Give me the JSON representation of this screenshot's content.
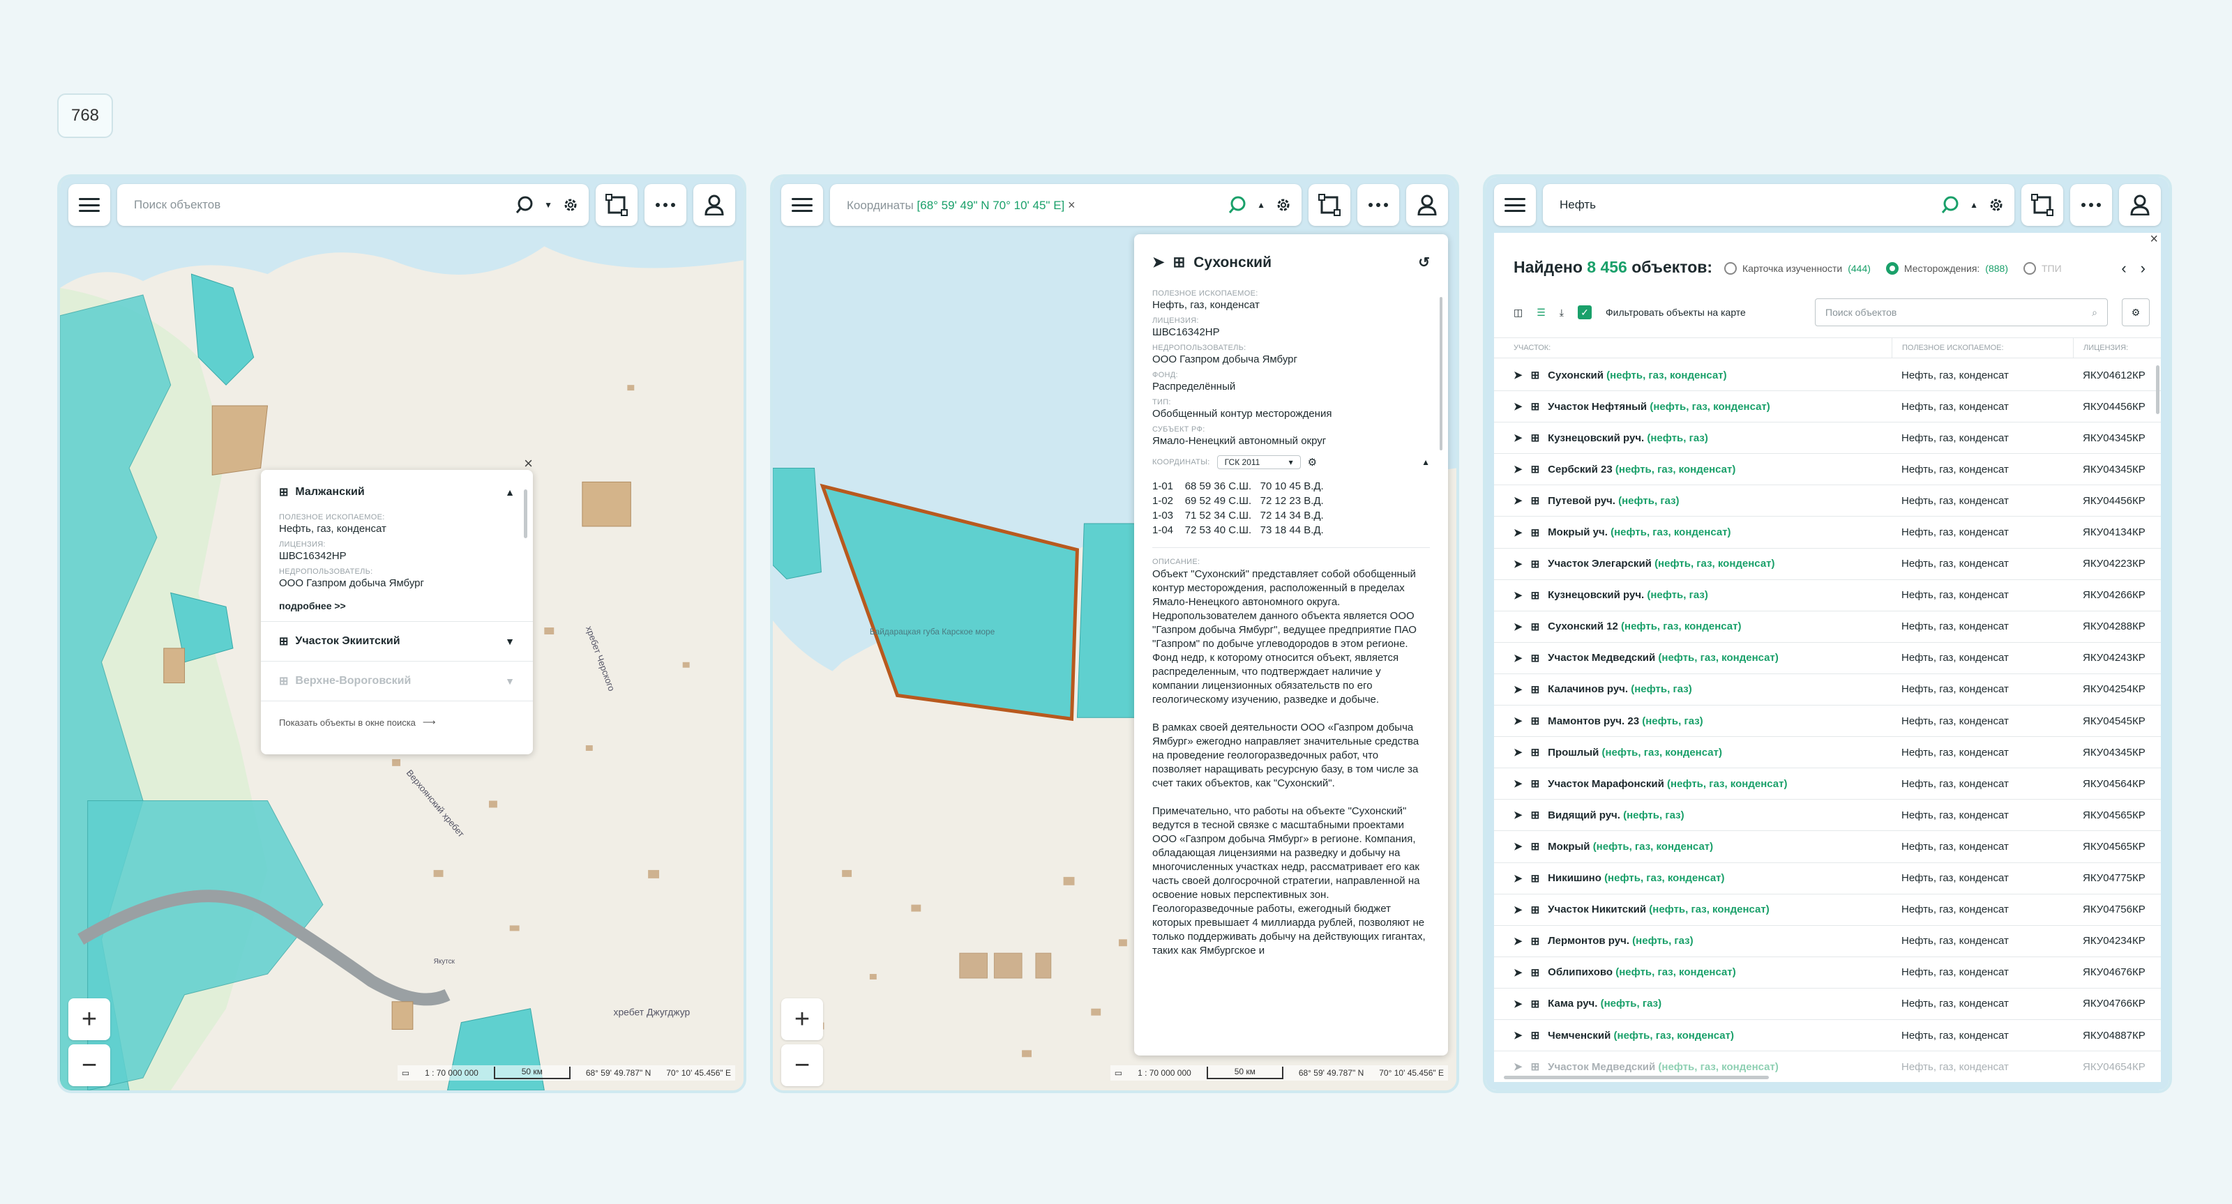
{
  "badge": "768",
  "common": {
    "scale_ratio": "1 : 70 000 000",
    "scale_label": "50 км",
    "lat": "68° 59' 49.787\" N",
    "lon": "70° 10' 45.456\" E"
  },
  "panel1": {
    "search_placeholder": "Поиск объектов",
    "map_labels": {
      "ridge1": "хребет Черского",
      "ridge2": "Верхоянский хребет",
      "ridge3": "хребет Джугджур",
      "city": "Якутск"
    },
    "popup": {
      "title": "Малжанский",
      "fields": [
        {
          "label": "Полезное ископаемое:",
          "value": "Нефть, газ, конденсат"
        },
        {
          "label": "Лицензия:",
          "value": "ШВС16342НР"
        },
        {
          "label": "Недропользователь:",
          "value": "ООО Газпром добыча Ямбург"
        }
      ],
      "more": "подробнее >>",
      "rows": [
        "Участок Экиитский",
        "Верхне-Вороговский"
      ],
      "show_link": "Показать объекты в окне поиска"
    }
  },
  "panel2": {
    "search_prefix": "Координаты",
    "search_coords": "[68° 59' 49\" N  70° 10' 45\" E]",
    "map_label": "Байдарацкая губа Карское море",
    "card": {
      "title": "Сухонский",
      "fields": [
        {
          "label": "Полезное ископаемое:",
          "value": "Нефть, газ, конденсат"
        },
        {
          "label": "Лицензия:",
          "value": "ШВС16342НР"
        },
        {
          "label": "Недропользователь:",
          "value": "ООО Газпром добыча Ямбург"
        },
        {
          "label": "Фонд:",
          "value": "Распределённый"
        },
        {
          "label": "Тип:",
          "value": "Обобщенный контур месторождения"
        },
        {
          "label": "Субъект РФ:",
          "value": "Ямало-Ненецкий автономный округ"
        }
      ],
      "coords_label": "Координаты:",
      "coords_system": "ГСК 2011",
      "coords": "1-01    68 59 36 С.Ш.   70 10 45 В.Д.\n1-02    69 52 49 С.Ш.   72 12 23 В.Д.\n1-03    71 52 34 С.Ш.   72 14 34 В.Д.\n1-04    72 53 40 С.Ш.   73 18 44 В.Д.",
      "desc_label": "Описание:",
      "desc": [
        "Объект \"Сухонский\" представляет собой обобщенный контур месторождения, расположенный в пределах Ямало-Ненецкого автономного округа. Недропользователем данного объекта является ООО \"Газпром добыча Ямбург\", ведущее предприятие ПАО \"Газпром\" по добыче углеводородов в этом регионе. Фонд недр, к которому относится объект, является распределенным, что подтверждает наличие у компании лицензионных обязательств по его геологическому изучению, разведке и добыче.",
        "В рамках своей деятельности ООО «Газпром добыча Ямбург» ежегодно направляет значительные средства на проведение геологоразведочных работ, что позволяет наращивать ресурсную базу, в том числе за счет таких объектов, как \"Сухонский\".",
        "Примечательно, что работы на объекте \"Сухонский\" ведутся в тесной связке с масштабными проектами ООО «Газпром добыча Ямбург» в регионе. Компания, обладающая лицензиями на разведку и добычу на многочисленных участках недр, рассматривает его как часть своей долгосрочной стратегии, направленной на освоение новых перспективных зон. Геологоразведочные работы, ежегодный бюджет которых превышает 4 миллиарда рублей, позволяют не только поддерживать добычу на действующих гигантах, таких как Ямбургское и"
      ]
    }
  },
  "panel3": {
    "search_value": "Нефть",
    "found_prefix": "Найдено",
    "found_count": "8 456",
    "found_suffix": "объектов:",
    "radios": [
      {
        "label": "Карточка изученности",
        "count": "(444)",
        "on": false
      },
      {
        "label": "Месторождения:",
        "count": "(888)",
        "on": true
      },
      {
        "label": "ТПИ",
        "count": "",
        "on": false
      }
    ],
    "filter_label": "Фильтровать объекты на карте",
    "search_placeholder": "Поиск объектов",
    "columns": [
      "Участок:",
      "Полезное ископаемое:",
      "Лицензия:"
    ],
    "rows": [
      {
        "name": "Сухонский",
        "tags": "(нефть, газ, конденсат)",
        "mineral": "Нефть, газ, конденсат",
        "license": "ЯКУ04612КР"
      },
      {
        "name": "Участок Нефтяный",
        "tags": "(нефть, газ, конденсат)",
        "mineral": "Нефть, газ, конденсат",
        "license": "ЯКУ04456КР"
      },
      {
        "name": "Кузнецовский руч.",
        "tags": "(нефть, газ)",
        "mineral": "Нефть, газ, конденсат",
        "license": "ЯКУ04345КР"
      },
      {
        "name": "Сербский 23",
        "tags": "(нефть, газ, конденсат)",
        "mineral": "Нефть, газ, конденсат",
        "license": "ЯКУ04345КР"
      },
      {
        "name": "Путевой руч.",
        "tags": "(нефть, газ)",
        "mineral": "Нефть, газ, конденсат",
        "license": "ЯКУ04456КР"
      },
      {
        "name": "Мокрый уч.",
        "tags": "(нефть, газ, конденсат)",
        "mineral": "Нефть, газ, конденсат",
        "license": "ЯКУ04134КР"
      },
      {
        "name": "Участок Элегарский",
        "tags": "(нефть, газ, конденсат)",
        "mineral": "Нефть, газ, конденсат",
        "license": "ЯКУ04223КР"
      },
      {
        "name": "Кузнецовский руч.",
        "tags": "(нефть, газ)",
        "mineral": "Нефть, газ, конденсат",
        "license": "ЯКУ04266КР"
      },
      {
        "name": "Сухонский 12",
        "tags": "(нефть, газ, конденсат)",
        "mineral": "Нефть, газ, конденсат",
        "license": "ЯКУ04288КР"
      },
      {
        "name": "Участок Медведский",
        "tags": "(нефть, газ, конденсат)",
        "mineral": "Нефть, газ, конденсат",
        "license": "ЯКУ04243КР"
      },
      {
        "name": "Калачинов руч.",
        "tags": "(нефть, газ)",
        "mineral": "Нефть, газ, конденсат",
        "license": "ЯКУ04254КР"
      },
      {
        "name": "Мамонтов руч. 23",
        "tags": "(нефть, газ)",
        "mineral": "Нефть, газ, конденсат",
        "license": "ЯКУ04545КР"
      },
      {
        "name": "Прошлый",
        "tags": "(нефть, газ, конденсат)",
        "mineral": "Нефть, газ, конденсат",
        "license": "ЯКУ04345КР"
      },
      {
        "name": "Участок Марафонский",
        "tags": "(нефть, газ, конденсат)",
        "mineral": "Нефть, газ, конденсат",
        "license": "ЯКУ04564КР"
      },
      {
        "name": "Видящий руч.",
        "tags": "(нефть, газ)",
        "mineral": "Нефть, газ, конденсат",
        "license": "ЯКУ04565КР"
      },
      {
        "name": "Мокрый",
        "tags": "(нефть, газ, конденсат)",
        "mineral": "Нефть, газ, конденсат",
        "license": "ЯКУ04565КР"
      },
      {
        "name": "Никишино",
        "tags": "(нефть, газ, конденсат)",
        "mineral": "Нефть, газ, конденсат",
        "license": "ЯКУ04775КР"
      },
      {
        "name": "Участок Никитский",
        "tags": "(нефть, газ, конденсат)",
        "mineral": "Нефть, газ, конденсат",
        "license": "ЯКУ04756КР"
      },
      {
        "name": "Лермонтов руч.",
        "tags": "(нефть, газ)",
        "mineral": "Нефть, газ, конденсат",
        "license": "ЯКУ04234КР"
      },
      {
        "name": "Облипихово",
        "tags": "(нефть, газ, конденсат)",
        "mineral": "Нефть, газ, конденсат",
        "license": "ЯКУ04676КР"
      },
      {
        "name": "Кама руч.",
        "tags": "(нефть, газ)",
        "mineral": "Нефть, газ, конденсат",
        "license": "ЯКУ04766КР"
      },
      {
        "name": "Чемченский",
        "tags": "(нефть, газ, конденсат)",
        "mineral": "Нефть, газ, конденсат",
        "license": "ЯКУ04887КР"
      },
      {
        "name": "Участок Медведский",
        "tags": "(нефть, газ, конденсат)",
        "mineral": "Нефть, газ, конденсат",
        "license": "ЯКУ04654КР"
      }
    ]
  }
}
